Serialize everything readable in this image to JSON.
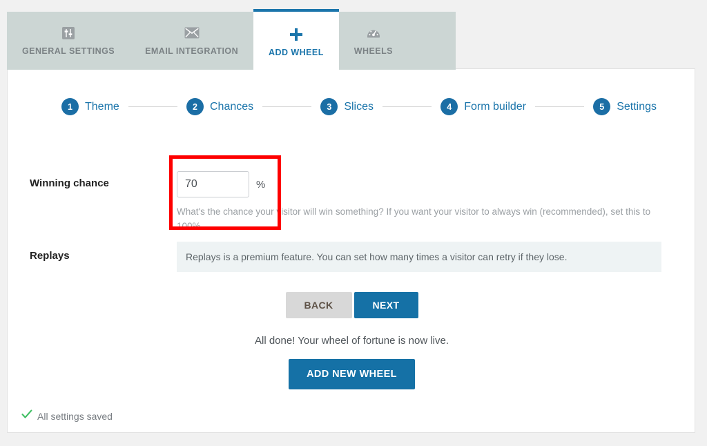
{
  "tabs": [
    {
      "label": "GENERAL SETTINGS",
      "icon": "sliders-icon",
      "active": false
    },
    {
      "label": "EMAIL INTEGRATION",
      "icon": "envelope-icon",
      "active": false
    },
    {
      "label": "ADD WHEEL",
      "icon": "plus-icon",
      "active": true
    },
    {
      "label": "WHEELS",
      "icon": "gauge-icon",
      "active": false
    }
  ],
  "stepper": {
    "steps": [
      {
        "number": "1",
        "label": "Theme"
      },
      {
        "number": "2",
        "label": "Chances"
      },
      {
        "number": "3",
        "label": "Slices"
      },
      {
        "number": "4",
        "label": "Form builder"
      },
      {
        "number": "5",
        "label": "Settings"
      }
    ]
  },
  "form": {
    "winning_chance": {
      "label": "Winning chance",
      "value": "70",
      "placeholder": "",
      "unit": "%",
      "help": "What's the chance your visitor will win something? If you want your visitor to always win (recommended), set this to 100%."
    },
    "replays": {
      "label": "Replays",
      "notice": "Replays is a premium feature. You can set how many times a visitor can retry if they lose."
    }
  },
  "actions": {
    "back_label": "BACK",
    "next_label": "NEXT",
    "done_message": "All done! Your wheel of fortune is now live.",
    "add_new_wheel_label": "ADD NEW WHEEL"
  },
  "status": {
    "saved_text": "All settings saved",
    "check_icon": "checkmark-icon"
  },
  "colors": {
    "accent": "#1571a6",
    "tab_strip": "#ccd6d4",
    "annotation": "#fe0000",
    "success": "#3fbf63",
    "notice_bg": "#eef3f4"
  }
}
